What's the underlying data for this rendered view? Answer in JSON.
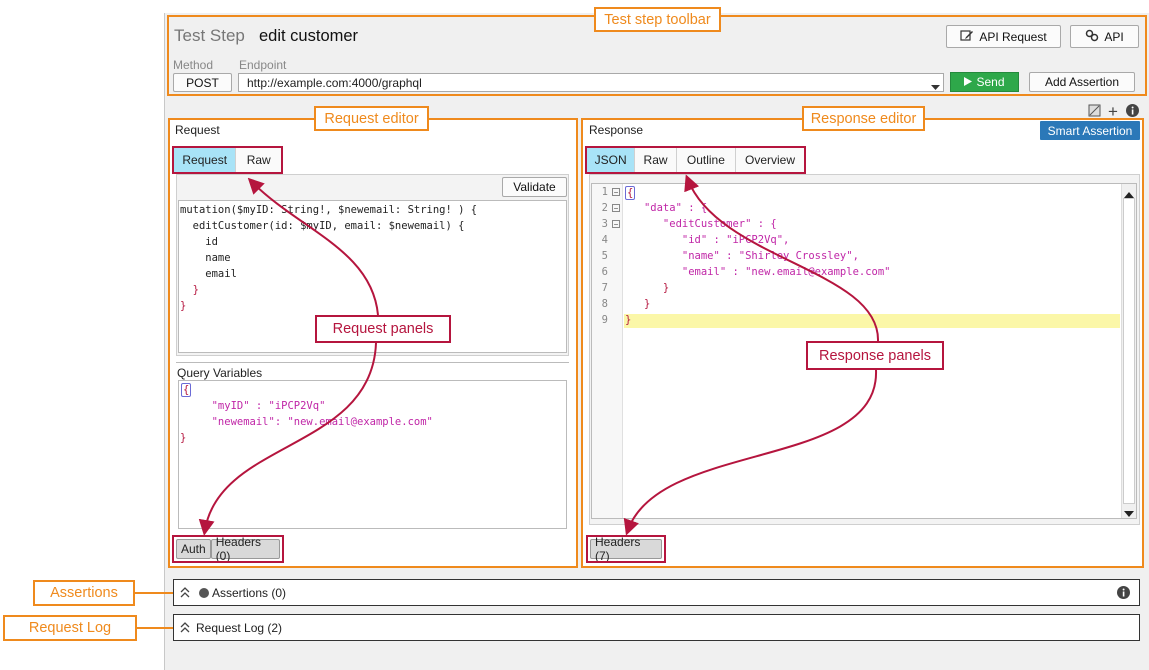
{
  "callouts": {
    "toolbar": "Test step toolbar",
    "request_editor": "Request editor",
    "response_editor": "Response editor",
    "assertions": "Assertions",
    "request_log": "Request Log",
    "request_panels": "Request panels",
    "response_panels": "Response panels"
  },
  "toolbar": {
    "prefix": "Test Step",
    "title": "edit customer",
    "api_request_button": "API Request",
    "api_button": "API",
    "method_label": "Method",
    "endpoint_label": "Endpoint",
    "method_value": "POST",
    "endpoint_value": "http://example.com:4000/graphql",
    "send_button": "Send",
    "add_assertion_button": "Add Assertion"
  },
  "request": {
    "header": "Request",
    "tabs": [
      "Request",
      "Raw"
    ],
    "validate_button": "Validate",
    "query_lines": [
      "mutation($myID: String!, $newemail: String! ) {",
      "  editCustomer(id: $myID, email: $newemail) {",
      "    id",
      "    name",
      "    email",
      "  }",
      "}"
    ],
    "query_variables_label": "Query Variables",
    "variables_lines": [
      "{",
      "",
      "     \"myID\" : \"iPCP2Vq\"",
      "     \"newemail\": \"new.email@example.com\"",
      "}"
    ],
    "bottom_tabs": [
      "Auth",
      "Headers (0)"
    ]
  },
  "response": {
    "header": "Response",
    "smart_assertion_button": "Smart Assertion",
    "tabs": [
      "JSON",
      "Raw",
      "Outline",
      "Overview"
    ],
    "line_numbers": [
      "1",
      "2",
      "3",
      "4",
      "5",
      "6",
      "7",
      "8",
      "9"
    ],
    "json_lines": [
      "{",
      "   \"data\" : {",
      "      \"editCustomer\" : {",
      "         \"id\" : \"iPCP2Vq\",",
      "         \"name\" : \"Shirley Crossley\",",
      "         \"email\" : \"new.email@example.com\"",
      "      }",
      "   }",
      "}"
    ],
    "bottom_tabs": [
      "Headers (7)"
    ]
  },
  "assertions_panel": {
    "label": "Assertions (0)"
  },
  "request_log_panel": {
    "label": "Request Log (2)"
  },
  "colors": {
    "accent_orange": "#ef8a1d",
    "callout_crimson": "#b5153e",
    "send_green": "#2ea84a",
    "smart_blue": "#2b78b8",
    "active_tab": "#a8e3f7",
    "highlight_line": "#fbf7a8"
  }
}
